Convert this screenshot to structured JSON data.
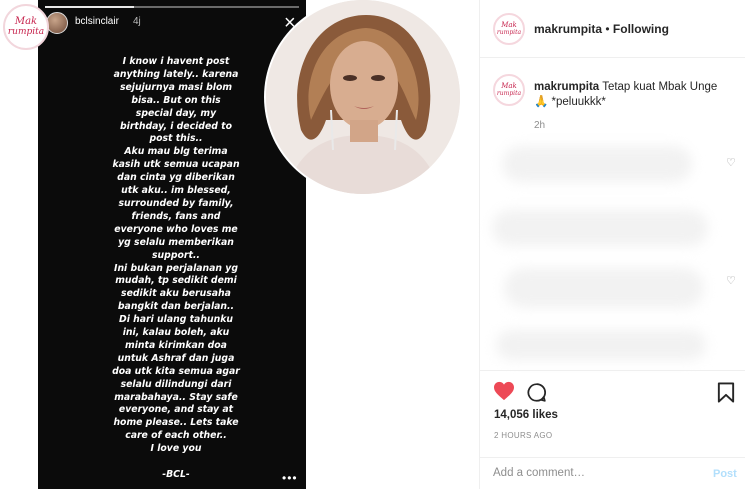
{
  "story": {
    "username": "bclsinclair",
    "time": "4j",
    "close_glyph": "×",
    "more_glyph": "•••",
    "progress": 0.35,
    "text": "I know i havent post\nanything lately.. karena\nsejujurnya masi blom\nbisa.. But on this\nspecial day, my\nbirthday, i decided to\npost this..\nAku mau blg terima\nkasih utk semua ucapan\ndan cinta yg diberikan\nutk aku.. im blessed,\nsurrounded by family,\nfriends, fans and\neveryone who loves me\nyg selalu memberikan\nsupport..\nIni bukan perjalanan yg\nmudah, tp sedikit demi\nsedikit aku berusaha\nbangkit dan berjalan..\nDi hari ulang tahunku\nini, kalau boleh, aku\nminta kirimkan doa\nuntuk Ashraf dan juga\ndoa utk kita semua agar\nselalu dilindungi dari\nmarabahaya.. Stay safe\neveryone, and stay at\nhome please.. Lets take\ncare of each other..\nI love you\n\n-BCL-"
  },
  "logo": {
    "line1": "Mak",
    "line2": "rumpita"
  },
  "header": {
    "username": "makrumpita",
    "separator": " • ",
    "follow_status": "Following"
  },
  "caption": {
    "username": "makrumpita",
    "text": "Tetap kuat Mbak Unge",
    "emoji": "🙏",
    "text2": "*peluukkk*",
    "time": "2h"
  },
  "comment_like_glyph": "♡",
  "likes": "14,056 likes",
  "posted_time": "2 HOURS AGO",
  "add_comment": {
    "placeholder": "Add a comment…",
    "post_label": "Post"
  },
  "colors": {
    "like_red": "#ed4956",
    "brand_pink": "#c7254e",
    "post_disabled": "#b2dffc"
  },
  "icons": [
    "heart-icon",
    "comment-icon",
    "bookmark-icon",
    "close-icon",
    "more-icon"
  ]
}
